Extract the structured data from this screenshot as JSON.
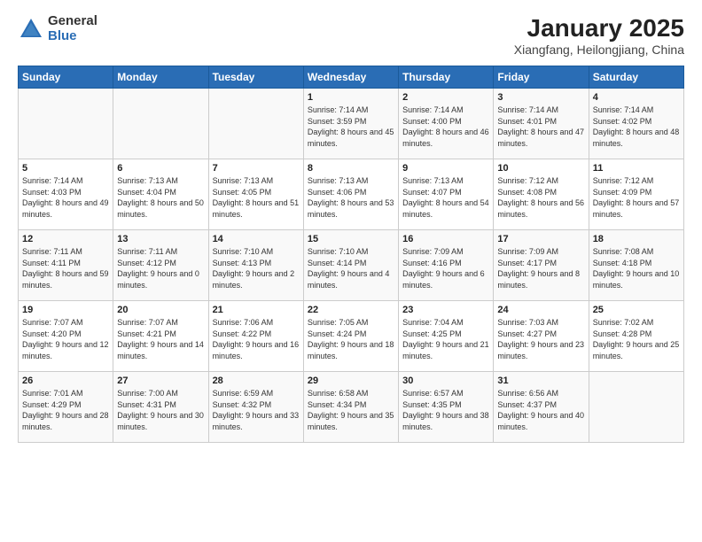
{
  "logo": {
    "general": "General",
    "blue": "Blue"
  },
  "header": {
    "month": "January 2025",
    "location": "Xiangfang, Heilongjiang, China"
  },
  "weekdays": [
    "Sunday",
    "Monday",
    "Tuesday",
    "Wednesday",
    "Thursday",
    "Friday",
    "Saturday"
  ],
  "weeks": [
    [
      {
        "day": "",
        "info": ""
      },
      {
        "day": "",
        "info": ""
      },
      {
        "day": "",
        "info": ""
      },
      {
        "day": "1",
        "info": "Sunrise: 7:14 AM\nSunset: 3:59 PM\nDaylight: 8 hours and 45 minutes."
      },
      {
        "day": "2",
        "info": "Sunrise: 7:14 AM\nSunset: 4:00 PM\nDaylight: 8 hours and 46 minutes."
      },
      {
        "day": "3",
        "info": "Sunrise: 7:14 AM\nSunset: 4:01 PM\nDaylight: 8 hours and 47 minutes."
      },
      {
        "day": "4",
        "info": "Sunrise: 7:14 AM\nSunset: 4:02 PM\nDaylight: 8 hours and 48 minutes."
      }
    ],
    [
      {
        "day": "5",
        "info": "Sunrise: 7:14 AM\nSunset: 4:03 PM\nDaylight: 8 hours and 49 minutes."
      },
      {
        "day": "6",
        "info": "Sunrise: 7:13 AM\nSunset: 4:04 PM\nDaylight: 8 hours and 50 minutes."
      },
      {
        "day": "7",
        "info": "Sunrise: 7:13 AM\nSunset: 4:05 PM\nDaylight: 8 hours and 51 minutes."
      },
      {
        "day": "8",
        "info": "Sunrise: 7:13 AM\nSunset: 4:06 PM\nDaylight: 8 hours and 53 minutes."
      },
      {
        "day": "9",
        "info": "Sunrise: 7:13 AM\nSunset: 4:07 PM\nDaylight: 8 hours and 54 minutes."
      },
      {
        "day": "10",
        "info": "Sunrise: 7:12 AM\nSunset: 4:08 PM\nDaylight: 8 hours and 56 minutes."
      },
      {
        "day": "11",
        "info": "Sunrise: 7:12 AM\nSunset: 4:09 PM\nDaylight: 8 hours and 57 minutes."
      }
    ],
    [
      {
        "day": "12",
        "info": "Sunrise: 7:11 AM\nSunset: 4:11 PM\nDaylight: 8 hours and 59 minutes."
      },
      {
        "day": "13",
        "info": "Sunrise: 7:11 AM\nSunset: 4:12 PM\nDaylight: 9 hours and 0 minutes."
      },
      {
        "day": "14",
        "info": "Sunrise: 7:10 AM\nSunset: 4:13 PM\nDaylight: 9 hours and 2 minutes."
      },
      {
        "day": "15",
        "info": "Sunrise: 7:10 AM\nSunset: 4:14 PM\nDaylight: 9 hours and 4 minutes."
      },
      {
        "day": "16",
        "info": "Sunrise: 7:09 AM\nSunset: 4:16 PM\nDaylight: 9 hours and 6 minutes."
      },
      {
        "day": "17",
        "info": "Sunrise: 7:09 AM\nSunset: 4:17 PM\nDaylight: 9 hours and 8 minutes."
      },
      {
        "day": "18",
        "info": "Sunrise: 7:08 AM\nSunset: 4:18 PM\nDaylight: 9 hours and 10 minutes."
      }
    ],
    [
      {
        "day": "19",
        "info": "Sunrise: 7:07 AM\nSunset: 4:20 PM\nDaylight: 9 hours and 12 minutes."
      },
      {
        "day": "20",
        "info": "Sunrise: 7:07 AM\nSunset: 4:21 PM\nDaylight: 9 hours and 14 minutes."
      },
      {
        "day": "21",
        "info": "Sunrise: 7:06 AM\nSunset: 4:22 PM\nDaylight: 9 hours and 16 minutes."
      },
      {
        "day": "22",
        "info": "Sunrise: 7:05 AM\nSunset: 4:24 PM\nDaylight: 9 hours and 18 minutes."
      },
      {
        "day": "23",
        "info": "Sunrise: 7:04 AM\nSunset: 4:25 PM\nDaylight: 9 hours and 21 minutes."
      },
      {
        "day": "24",
        "info": "Sunrise: 7:03 AM\nSunset: 4:27 PM\nDaylight: 9 hours and 23 minutes."
      },
      {
        "day": "25",
        "info": "Sunrise: 7:02 AM\nSunset: 4:28 PM\nDaylight: 9 hours and 25 minutes."
      }
    ],
    [
      {
        "day": "26",
        "info": "Sunrise: 7:01 AM\nSunset: 4:29 PM\nDaylight: 9 hours and 28 minutes."
      },
      {
        "day": "27",
        "info": "Sunrise: 7:00 AM\nSunset: 4:31 PM\nDaylight: 9 hours and 30 minutes."
      },
      {
        "day": "28",
        "info": "Sunrise: 6:59 AM\nSunset: 4:32 PM\nDaylight: 9 hours and 33 minutes."
      },
      {
        "day": "29",
        "info": "Sunrise: 6:58 AM\nSunset: 4:34 PM\nDaylight: 9 hours and 35 minutes."
      },
      {
        "day": "30",
        "info": "Sunrise: 6:57 AM\nSunset: 4:35 PM\nDaylight: 9 hours and 38 minutes."
      },
      {
        "day": "31",
        "info": "Sunrise: 6:56 AM\nSunset: 4:37 PM\nDaylight: 9 hours and 40 minutes."
      },
      {
        "day": "",
        "info": ""
      }
    ]
  ]
}
